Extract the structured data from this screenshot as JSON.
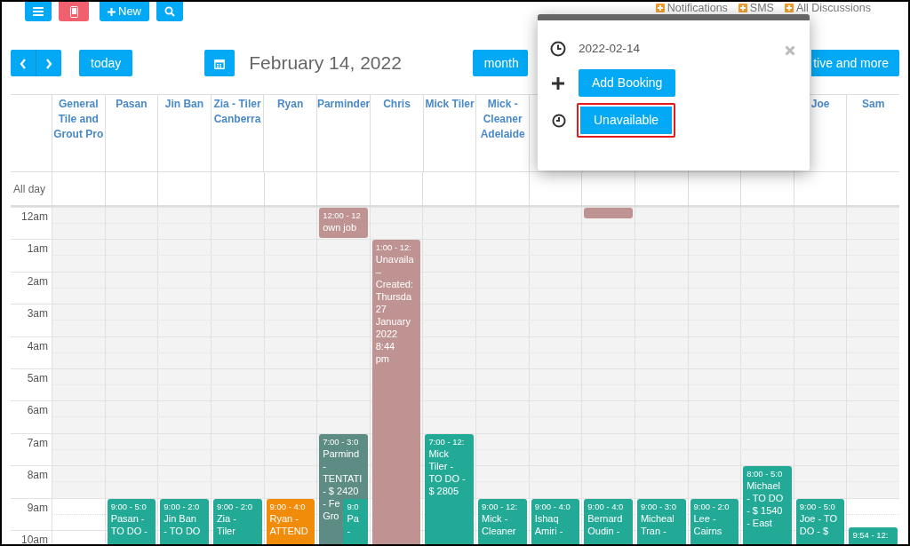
{
  "top_bar": {
    "buttons": [
      {
        "kind": "menu"
      },
      {
        "kind": "mobile"
      },
      {
        "kind": "new",
        "label": "New"
      },
      {
        "kind": "search"
      }
    ],
    "links": [
      "Notifications",
      "SMS",
      "All Discussions"
    ]
  },
  "toolbar": {
    "today": "today",
    "date_title": "February 14, 2022",
    "view_button": "month",
    "more_button": "tive and more"
  },
  "calendar": {
    "all_day_label": "All day",
    "hours": [
      {
        "label": "12am",
        "business": false
      },
      {
        "label": "1am",
        "business": false
      },
      {
        "label": "2am",
        "business": false
      },
      {
        "label": "3am",
        "business": false
      },
      {
        "label": "4am",
        "business": false
      },
      {
        "label": "5am",
        "business": false
      },
      {
        "label": "6am",
        "business": false
      },
      {
        "label": "7am",
        "business": false
      },
      {
        "label": "8am",
        "business": false
      },
      {
        "label": "9am",
        "business": true
      },
      {
        "label": "10am",
        "business": true
      }
    ],
    "resources": [
      {
        "name": "General Tile and Grout Pro"
      },
      {
        "name": "Pasan",
        "events": [
          {
            "kind": "block",
            "color": "#22aa96",
            "time": "9:00 - 5:0",
            "lines": [
              "Pasan -",
              "TO DO -"
            ]
          }
        ]
      },
      {
        "name": "Jin Ban",
        "events": [
          {
            "kind": "block",
            "color": "#22aa96",
            "time": "9:00 - 2:0",
            "lines": [
              "Jin Ban",
              "- TO DO"
            ]
          }
        ]
      },
      {
        "name": "Zia - Tiler Canberra",
        "events": [
          {
            "kind": "block",
            "color": "#22aa96",
            "time": "9:00 - 2:0",
            "lines": [
              "Zia -",
              "Tiler"
            ]
          }
        ]
      },
      {
        "name": "Ryan",
        "events": [
          {
            "kind": "block",
            "color": "#f08c0a",
            "time": "9:00 - 4:0",
            "lines": [
              "Ryan -",
              "ATTEND"
            ]
          }
        ]
      },
      {
        "name": "Parminder",
        "events": [
          {
            "kind": "short",
            "color": "#c09393",
            "time": "12:00 - 12",
            "lines": [
              "own job"
            ]
          },
          {
            "kind": "block",
            "color": "#5c8c84",
            "time": "7:00 - 3:0",
            "lines": [
              "Parmind",
              "-",
              "TENTATI",
              "- $ 2420",
              "- Fe",
              "Gro"
            ]
          },
          {
            "kind": "inset",
            "color": "#22aa96",
            "time": "9:0",
            "lines": [
              "Pa",
              "-"
            ]
          }
        ]
      },
      {
        "name": "Chris",
        "events": [
          {
            "kind": "block",
            "color": "#c09393",
            "time": "1:00 - 12:",
            "lines": [
              "Unavaila",
              "–",
              "Created:",
              "Thursda",
              "27",
              "January",
              "2022",
              "8:44",
              "pm"
            ]
          }
        ]
      },
      {
        "name": "Mick Tiler",
        "events": [
          {
            "kind": "block",
            "color": "#22aa96",
            "time": "7:00 - 12:",
            "lines": [
              "Mick",
              "Tiler -",
              "TO DO -",
              "$ 2805"
            ]
          }
        ]
      },
      {
        "name": "Mick - Cleaner Adelaide",
        "events": [
          {
            "kind": "block",
            "color": "#22aa96",
            "time": "9:00 - 12:",
            "lines": [
              "Mick -",
              "Cleaner"
            ]
          }
        ]
      },
      {
        "events": [
          {
            "kind": "block",
            "color": "#22aa96",
            "time": "9:00 - 4:0",
            "lines": [
              "Ishaq",
              "Amiri -"
            ]
          }
        ]
      },
      {
        "events": [
          {
            "kind": "sliver",
            "color": "#c09393"
          },
          {
            "kind": "block",
            "color": "#22aa96",
            "time": "9:00 - 4:0",
            "lines": [
              "Bernard",
              "Oudin -"
            ]
          }
        ]
      },
      {
        "events": [
          {
            "kind": "block",
            "color": "#22aa96",
            "time": "9:00 - 3:0",
            "lines": [
              "Micheal",
              "Tran -"
            ]
          }
        ]
      },
      {
        "events": [
          {
            "kind": "block",
            "color": "#22aa96",
            "time": "9:00 - 2:0",
            "lines": [
              "Lee -",
              "Cairns"
            ]
          }
        ]
      },
      {
        "events": [
          {
            "kind": "block",
            "color": "#22aa96",
            "time": "8:00 - 5:0",
            "lines": [
              "Michael",
              "- TO DO",
              "- $ 1540",
              "- East"
            ]
          }
        ]
      },
      {
        "name": "Joe",
        "events": [
          {
            "kind": "block",
            "color": "#22aa96",
            "time": "9:00 - 5:0",
            "lines": [
              "Joe - TO",
              "DO - $"
            ]
          }
        ]
      },
      {
        "name": "Sam",
        "events": [
          {
            "kind": "block",
            "color": "#22aa96",
            "time": "9:54 - 12:"
          }
        ]
      }
    ]
  },
  "popover": {
    "date": "2022-02-14",
    "actions": [
      {
        "kind": "add",
        "label": "Add Booking",
        "highlighted": false
      },
      {
        "kind": "unavailable",
        "label": "Unavailable",
        "highlighted": true
      }
    ]
  }
}
